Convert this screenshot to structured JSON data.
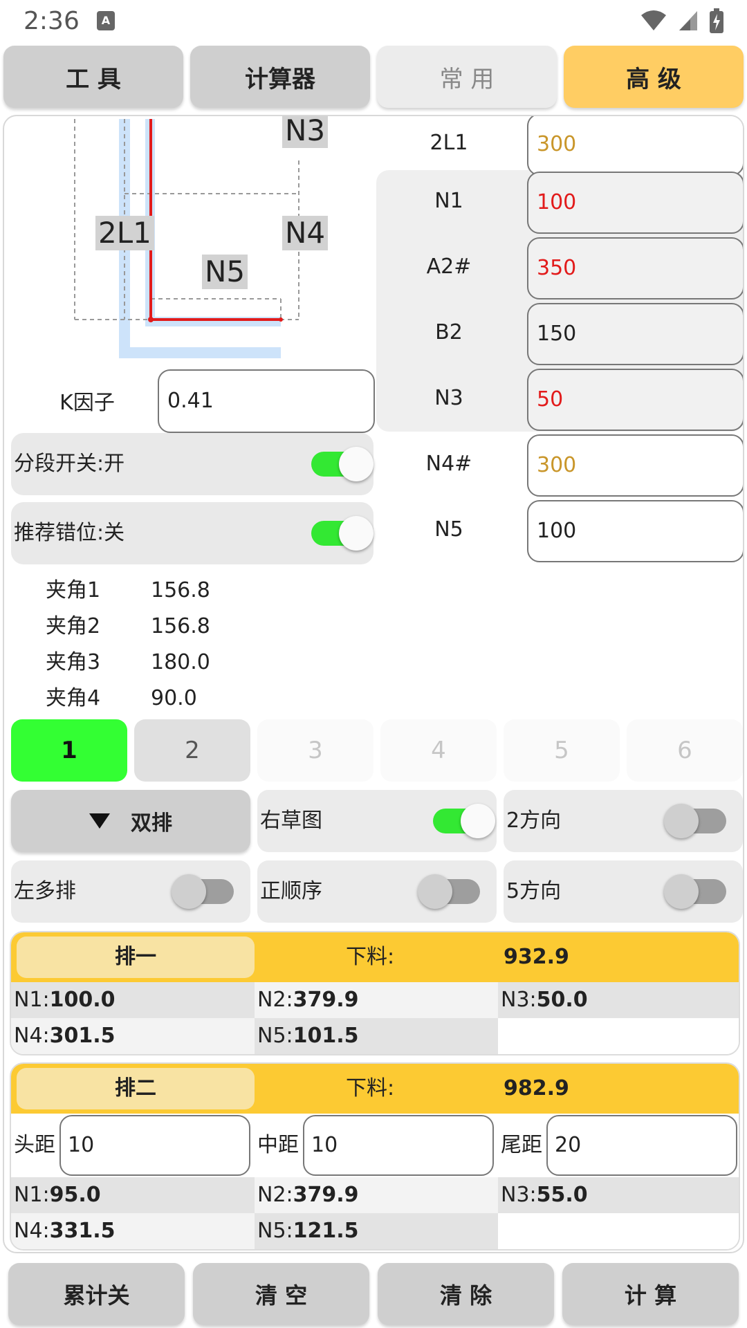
{
  "status_bar": {
    "time": "2:36",
    "notif_icon": "A"
  },
  "tabs": [
    {
      "label": "工 具"
    },
    {
      "label": "计算器"
    },
    {
      "label": "常 用"
    },
    {
      "label": "高 级"
    }
  ],
  "diagram": {
    "labels": {
      "n3": "N3",
      "l2": "2L1",
      "n4": "N4",
      "n5": "N5"
    }
  },
  "params": [
    {
      "label": "2L1",
      "value": "300"
    },
    {
      "label": "N1",
      "value": "100"
    },
    {
      "label": "A2#",
      "value": "350"
    },
    {
      "label": "B2",
      "value": "150"
    },
    {
      "label": "N3",
      "value": "50"
    },
    {
      "label": "N4#",
      "value": "300"
    },
    {
      "label": "N5",
      "value": "100"
    }
  ],
  "k_factor": {
    "label": "K因子",
    "value": "0.41"
  },
  "toggles": {
    "segment": {
      "label": "分段开关:开",
      "on": true
    },
    "offset": {
      "label": "推荐错位:关",
      "on": true
    }
  },
  "angles": [
    {
      "label": "夹角1",
      "value": "156.8"
    },
    {
      "label": "夹角2",
      "value": "156.8"
    },
    {
      "label": "夹角3",
      "value": "180.0"
    },
    {
      "label": "夹角4",
      "value": "90.0"
    }
  ],
  "number_tabs": [
    "1",
    "2",
    "3",
    "4",
    "5",
    "6"
  ],
  "options": {
    "dropdown": "双排",
    "right_sketch": {
      "label": "右草图",
      "on": true
    },
    "dir2": {
      "label": "2方向",
      "on": false
    },
    "left_multi": {
      "label": "左多排",
      "on": false
    },
    "forward_order": {
      "label": "正顺序",
      "on": false
    },
    "dir5": {
      "label": "5方向",
      "on": false
    }
  },
  "row1": {
    "title": "排一",
    "cut_label": "下料:",
    "cut_value": "932.9",
    "cells": [
      {
        "k": "N1:",
        "v": "100.0"
      },
      {
        "k": "N2:",
        "v": "379.9"
      },
      {
        "k": "N3:",
        "v": "50.0"
      },
      {
        "k": "N4:",
        "v": "301.5"
      },
      {
        "k": "N5:",
        "v": "101.5"
      }
    ]
  },
  "row2": {
    "title": "排二",
    "cut_label": "下料:",
    "cut_value": "982.9",
    "head_label": "头距",
    "head_value": "10",
    "mid_label": "中距",
    "mid_value": "10",
    "tail_label": "尾距",
    "tail_value": "20",
    "cells": [
      {
        "k": "N1:",
        "v": "95.0"
      },
      {
        "k": "N2:",
        "v": "379.9"
      },
      {
        "k": "N3:",
        "v": "55.0"
      },
      {
        "k": "N4:",
        "v": "331.5"
      },
      {
        "k": "N5:",
        "v": "121.5"
      }
    ]
  },
  "bottom_buttons": [
    "累计关",
    "清 空",
    "清 除",
    "计 算"
  ],
  "colors": {
    "accent": "#ffcd63",
    "header": "#fcca33",
    "active": "#33ff33",
    "red": "#e21b1b",
    "gold": "#c9962a"
  },
  "icons": [
    "wifi-icon",
    "signal-icon",
    "battery-charging-icon",
    "triangle-down-icon"
  ]
}
